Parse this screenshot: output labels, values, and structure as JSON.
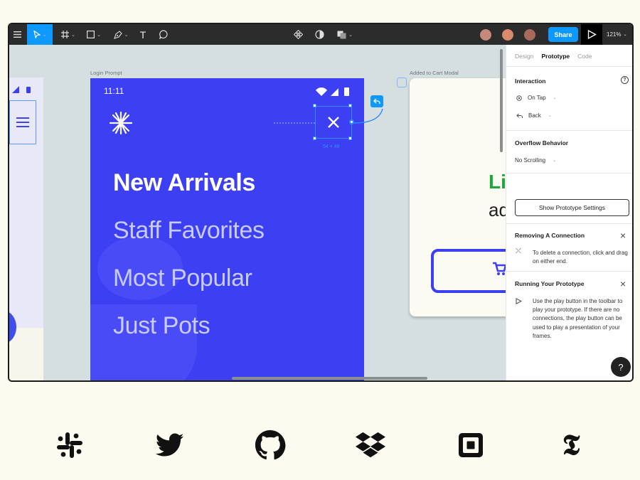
{
  "toolbar": {
    "menu_icon": "hamburger-icon",
    "tools": [
      "move-tool",
      "frame-tool",
      "shape-tool",
      "pen-tool",
      "text-tool",
      "comment-tool"
    ],
    "text_tool_glyph": "T",
    "share_label": "Share",
    "zoom_label": "121%",
    "colors": {
      "bar": "#2c2c2c",
      "accent": "#0d99ff"
    }
  },
  "canvas": {
    "login_label": "Login Prompt",
    "cart_label": "Added to Cart Modal",
    "phone": {
      "time": "11:11",
      "nav": [
        "New Arrivals",
        "Staff Favorites",
        "Most Popular",
        "Just Pots"
      ],
      "color": "#3c3ff2"
    },
    "selection_size": "54 × 48",
    "cart": {
      "line1": "Li",
      "line2": "ad"
    }
  },
  "panel": {
    "tabs": [
      "Design",
      "Prototype",
      "Code"
    ],
    "interaction_title": "Interaction",
    "trigger": "On Tap",
    "action": "Back",
    "overflow_title": "Overflow Behavior",
    "overflow_value": "No Scrolling",
    "settings_button": "Show Prototype Settings",
    "tip1": {
      "title": "Removing A Connection",
      "text": "To delete a connection, click and drag on either end."
    },
    "tip2": {
      "title": "Running Your Prototype",
      "text": "Use the play button in the toolbar to play your prototype. If there are no connections, the play button can be used to play a presentation of your frames."
    },
    "help_label": "?"
  },
  "logos": [
    "slack-icon",
    "twitter-icon",
    "github-icon",
    "dropbox-icon",
    "square-icon",
    "nytimes-icon"
  ],
  "nyt_glyph": "𝕿"
}
